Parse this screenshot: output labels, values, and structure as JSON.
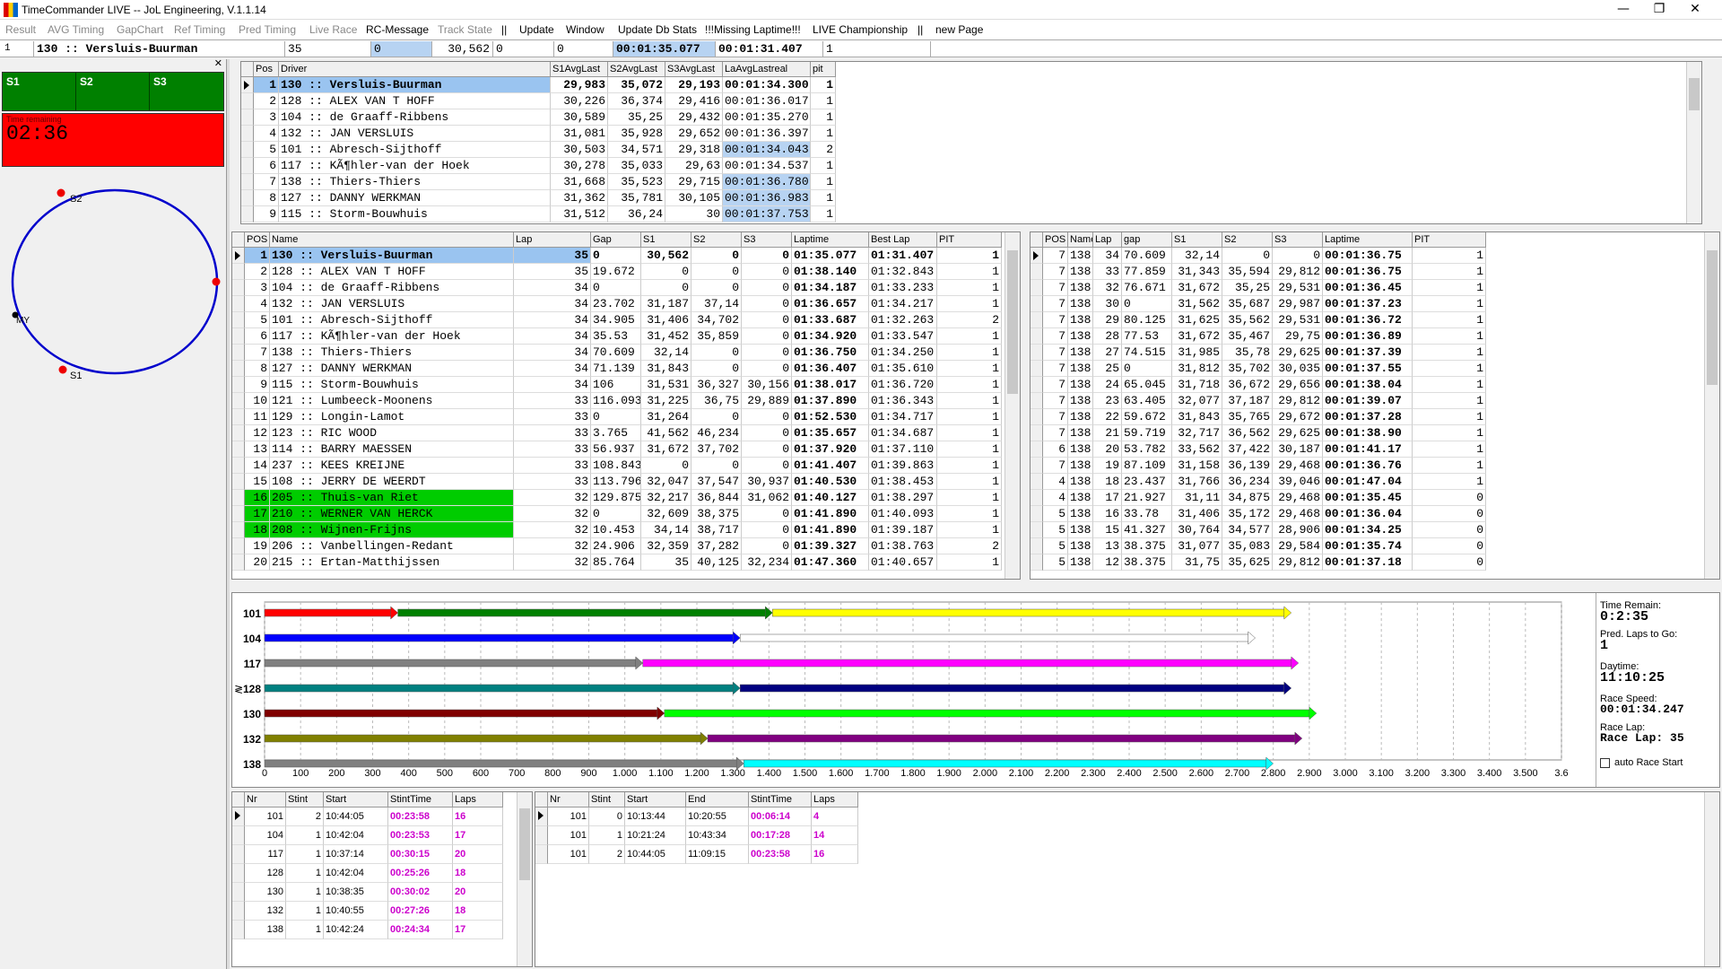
{
  "window": {
    "title": "TimeCommander LIVE -- JoL Engineering, V.1.1.14",
    "minimize": "—",
    "maximize": "❐",
    "close": "✕"
  },
  "menu": [
    "Result",
    "AVG Timing",
    "GapChart",
    "Ref Timing",
    "Pred Timing",
    "Live Race",
    "RC-Message",
    "Track State",
    "||",
    "Update",
    "Window",
    "Update Db Stats",
    "!!!Missing Laptime!!!",
    "LIVE Championship",
    "||",
    "new Page"
  ],
  "infobar": {
    "index": "1",
    "driver": "130  ::  Versluis-Buurman",
    "lap": "35",
    "v1": "0",
    "v2": "30,562",
    "v3": "0",
    "v4": "0",
    "laptime": "00:01:35.077",
    "best": "00:01:31.407",
    "pit": "1"
  },
  "sectors": {
    "s1": "S1",
    "s2": "S2",
    "s3": "S3",
    "time_remaining_label": "Time remaining",
    "time_remaining": "02:36"
  },
  "track": {
    "s1": "S1",
    "s2": "S2",
    "my": "MY"
  },
  "avg_table": {
    "headers": [
      "Pos",
      "Driver",
      "S1AvgLast",
      "S2AvgLast",
      "S3AvgLast",
      "LaAvgLastreal",
      "pit"
    ],
    "rows": [
      [
        "1",
        "130  ::  Versluis-Buurman",
        "29,983",
        "35,072",
        "29,193",
        "00:01:34.300",
        "1"
      ],
      [
        "2",
        "128  ::  ALEX VAN T HOFF",
        "30,226",
        "36,374",
        "29,416",
        "00:01:36.017",
        "1"
      ],
      [
        "3",
        "104  ::  de Graaff-Ribbens",
        "30,589",
        "35,25",
        "29,432",
        "00:01:35.270",
        "1"
      ],
      [
        "4",
        "132  ::  JAN VERSLUIS",
        "31,081",
        "35,928",
        "29,652",
        "00:01:36.397",
        "1"
      ],
      [
        "5",
        "101  ::  Abresch-Sijthoff",
        "30,503",
        "34,571",
        "29,318",
        "00:01:34.043",
        "2"
      ],
      [
        "6",
        "117  ::  KÃ¶hler-van der Hoek",
        "30,278",
        "35,033",
        "29,63",
        "00:01:34.537",
        "1"
      ],
      [
        "7",
        "138  ::  Thiers-Thiers",
        "31,668",
        "35,523",
        "29,715",
        "00:01:36.780",
        "1"
      ],
      [
        "8",
        "127  ::  DANNY WERKMAN",
        "31,362",
        "35,781",
        "30,105",
        "00:01:36.983",
        "1"
      ],
      [
        "9",
        "115  ::  Storm-Bouwhuis",
        "31,512",
        "36,24",
        "30",
        "00:01:37.753",
        "1"
      ]
    ]
  },
  "race_table": {
    "headers": [
      "POS",
      "Name",
      "Lap",
      "Gap",
      "S1",
      "S2",
      "S3",
      "Laptime",
      "Best Lap",
      "PIT"
    ],
    "rows": [
      [
        "1",
        "130  ::  Versluis-Buurman",
        "35",
        "0",
        "30,562",
        "0",
        "0",
        "01:35.077",
        "01:31.407",
        "1"
      ],
      [
        "2",
        "128  ::  ALEX VAN T HOFF",
        "35",
        "19.672",
        "0",
        "0",
        "0",
        "01:38.140",
        "01:32.843",
        "1"
      ],
      [
        "3",
        "104  ::  de Graaff-Ribbens",
        "34",
        "0",
        "0",
        "0",
        "0",
        "01:34.187",
        "01:33.233",
        "1"
      ],
      [
        "4",
        "132  ::  JAN VERSLUIS",
        "34",
        "23.702",
        "31,187",
        "37,14",
        "0",
        "01:36.657",
        "01:34.217",
        "1"
      ],
      [
        "5",
        "101  ::  Abresch-Sijthoff",
        "34",
        "34.905",
        "31,406",
        "34,702",
        "0",
        "01:33.687",
        "01:32.263",
        "2"
      ],
      [
        "6",
        "117  ::  KÃ¶hler-van der Hoek",
        "34",
        "35.53",
        "31,452",
        "35,859",
        "0",
        "01:34.920",
        "01:33.547",
        "1"
      ],
      [
        "7",
        "138  ::  Thiers-Thiers",
        "34",
        "70.609",
        "32,14",
        "0",
        "0",
        "01:36.750",
        "01:34.250",
        "1"
      ],
      [
        "8",
        "127  ::  DANNY WERKMAN",
        "34",
        "71.139",
        "31,843",
        "0",
        "0",
        "01:36.407",
        "01:35.610",
        "1"
      ],
      [
        "9",
        "115  ::  Storm-Bouwhuis",
        "34",
        "106",
        "31,531",
        "36,327",
        "30,156",
        "01:38.017",
        "01:36.720",
        "1"
      ],
      [
        "10",
        "121  ::  Lumbeeck-Moonens",
        "33",
        "116.093",
        "31,225",
        "36,75",
        "29,889",
        "01:37.890",
        "01:36.343",
        "1"
      ],
      [
        "11",
        "129  ::  Longin-Lamot",
        "33",
        "0",
        "31,264",
        "0",
        "0",
        "01:52.530",
        "01:34.717",
        "1"
      ],
      [
        "12",
        "123  ::  RIC WOOD",
        "33",
        "3.765",
        "41,562",
        "46,234",
        "0",
        "01:35.657",
        "01:34.687",
        "1"
      ],
      [
        "13",
        "114  ::  BARRY MAESSEN",
        "33",
        "56.937",
        "31,672",
        "37,702",
        "0",
        "01:37.920",
        "01:37.110",
        "1"
      ],
      [
        "14",
        "237  ::  KEES KREIJNE",
        "33",
        "108.843",
        "0",
        "0",
        "0",
        "01:41.407",
        "01:39.863",
        "1"
      ],
      [
        "15",
        "108  ::  JERRY DE WEERDT",
        "33",
        "113.796",
        "32,047",
        "37,547",
        "30,937",
        "01:40.530",
        "01:38.453",
        "1"
      ],
      [
        "16",
        "205  ::  Thuis-van Riet",
        "32",
        "129.875",
        "32,217",
        "36,844",
        "31,062",
        "01:40.127",
        "01:38.297",
        "1"
      ],
      [
        "17",
        "210  ::  WERNER VAN HERCK",
        "32",
        "0",
        "32,609",
        "38,375",
        "0",
        "01:41.890",
        "01:40.093",
        "1"
      ],
      [
        "18",
        "208  ::  Wijnen-Frijns",
        "32",
        "10.453",
        "34,14",
        "38,717",
        "0",
        "01:41.890",
        "01:39.187",
        "1"
      ],
      [
        "19",
        "206  ::  Vanbellingen-Redant",
        "32",
        "24.906",
        "32,359",
        "37,282",
        "0",
        "01:39.327",
        "01:38.763",
        "2"
      ],
      [
        "20",
        "215  ::  Ertan-Matthijssen",
        "32",
        "85.764",
        "35",
        "40,125",
        "32,234",
        "01:47.360",
        "01:40.657",
        "1"
      ]
    ]
  },
  "lap_table": {
    "headers": [
      "POS",
      "Name",
      "Lap",
      "gap",
      "S1",
      "S2",
      "S3",
      "Laptime",
      "PIT"
    ],
    "rows": [
      [
        "7",
        "138",
        "34",
        "70.609",
        "32,14",
        "0",
        "0",
        "00:01:36.75",
        "1"
      ],
      [
        "7",
        "138",
        "33",
        "77.859",
        "31,343",
        "35,594",
        "29,812",
        "00:01:36.75",
        "1"
      ],
      [
        "7",
        "138",
        "32",
        "76.671",
        "31,672",
        "35,25",
        "29,531",
        "00:01:36.45",
        "1"
      ],
      [
        "7",
        "138",
        "30",
        "0",
        "31,562",
        "35,687",
        "29,987",
        "00:01:37.23",
        "1"
      ],
      [
        "7",
        "138",
        "29",
        "80.125",
        "31,625",
        "35,562",
        "29,531",
        "00:01:36.72",
        "1"
      ],
      [
        "7",
        "138",
        "28",
        "77.53",
        "31,672",
        "35,467",
        "29,75",
        "00:01:36.89",
        "1"
      ],
      [
        "7",
        "138",
        "27",
        "74.515",
        "31,985",
        "35,78",
        "29,625",
        "00:01:37.39",
        "1"
      ],
      [
        "7",
        "138",
        "25",
        "0",
        "31,812",
        "35,702",
        "30,035",
        "00:01:37.55",
        "1"
      ],
      [
        "7",
        "138",
        "24",
        "65.045",
        "31,718",
        "36,672",
        "29,656",
        "00:01:38.04",
        "1"
      ],
      [
        "7",
        "138",
        "23",
        "63.405",
        "32,077",
        "37,187",
        "29,812",
        "00:01:39.07",
        "1"
      ],
      [
        "7",
        "138",
        "22",
        "59.672",
        "31,843",
        "35,765",
        "29,672",
        "00:01:37.28",
        "1"
      ],
      [
        "7",
        "138",
        "21",
        "59.719",
        "32,717",
        "36,562",
        "29,625",
        "00:01:38.90",
        "1"
      ],
      [
        "6",
        "138",
        "20",
        "53.782",
        "33,562",
        "37,422",
        "30,187",
        "00:01:41.17",
        "1"
      ],
      [
        "7",
        "138",
        "19",
        "87.109",
        "31,158",
        "36,139",
        "29,468",
        "00:01:36.76",
        "1"
      ],
      [
        "4",
        "138",
        "18",
        "23.437",
        "31,766",
        "36,234",
        "39,046",
        "00:01:47.04",
        "1"
      ],
      [
        "4",
        "138",
        "17",
        "21.927",
        "31,11",
        "34,875",
        "29,468",
        "00:01:35.45",
        "0"
      ],
      [
        "5",
        "138",
        "16",
        "33.78",
        "31,406",
        "35,172",
        "29,468",
        "00:01:36.04",
        "0"
      ],
      [
        "5",
        "138",
        "15",
        "41.327",
        "30,764",
        "34,577",
        "28,906",
        "00:01:34.25",
        "0"
      ],
      [
        "5",
        "138",
        "13",
        "38.375",
        "31,077",
        "35,083",
        "29,584",
        "00:01:35.74",
        "0"
      ],
      [
        "5",
        "138",
        "12",
        "38.375",
        "31,75",
        "35,625",
        "29,812",
        "00:01:37.18",
        "0"
      ]
    ]
  },
  "stint_chart": {
    "rows": [
      {
        "label": "101",
        "segments": [
          {
            "start": 0,
            "end": 370,
            "color": "#ff0000"
          },
          {
            "start": 370,
            "end": 1410,
            "color": "#008000"
          },
          {
            "start": 1410,
            "end": 2850,
            "color": "#ffff00"
          }
        ]
      },
      {
        "label": "104",
        "segments": [
          {
            "start": 0,
            "end": 1320,
            "color": "#0000ff"
          },
          {
            "start": 1320,
            "end": 2750,
            "color": "#ffffff"
          }
        ]
      },
      {
        "label": "117",
        "segments": [
          {
            "start": 0,
            "end": 1050,
            "color": "#808080"
          },
          {
            "start": 1050,
            "end": 2870,
            "color": "#ff00ff"
          }
        ]
      },
      {
        "label": "128",
        "segments": [
          {
            "start": 0,
            "end": 1320,
            "color": "#008080"
          },
          {
            "start": 1320,
            "end": 2850,
            "color": "#000080"
          }
        ]
      },
      {
        "label": "130",
        "segments": [
          {
            "start": 0,
            "end": 1110,
            "color": "#800000"
          },
          {
            "start": 1110,
            "end": 2920,
            "color": "#00ff00"
          }
        ]
      },
      {
        "label": "132",
        "segments": [
          {
            "start": 0,
            "end": 1230,
            "color": "#808000"
          },
          {
            "start": 1230,
            "end": 2880,
            "color": "#800080"
          }
        ]
      },
      {
        "label": "138",
        "segments": [
          {
            "start": 0,
            "end": 1330,
            "color": "#808080"
          },
          {
            "start": 1330,
            "end": 2800,
            "color": "#00ffff"
          }
        ]
      }
    ],
    "xticks": [
      "0",
      "100",
      "200",
      "300",
      "400",
      "500",
      "600",
      "700",
      "800",
      "900",
      "1.000",
      "1.100",
      "1.200",
      "1.300",
      "1.400",
      "1.500",
      "1.600",
      "1.700",
      "1.800",
      "1.900",
      "2.000",
      "2.100",
      "2.200",
      "2.300",
      "2.400",
      "2.500",
      "2.600",
      "2.700",
      "2.800",
      "2.900",
      "3.000",
      "3.100",
      "3.200",
      "3.300",
      "3.400",
      "3.500",
      "3.6"
    ],
    "xmax": 3600,
    "marker": "≷"
  },
  "race_info": {
    "time_remain_label": "Time Remain:",
    "time_remain": "0:2:35",
    "pred_laps_label": "Pred. Laps to Go:",
    "pred_laps": "1",
    "daytime_label": "Daytime:",
    "daytime": "11:10:25",
    "race_speed_label": "Race Speed:",
    "race_speed": "00:01:34.247",
    "race_lap_label": "Race Lap:",
    "race_lap": "Race Lap: 35",
    "auto_start_label": "auto Race Start"
  },
  "stint_table": {
    "headers": [
      "Nr",
      "Stint",
      "Start",
      "StintTime",
      "Laps"
    ],
    "rows": [
      [
        "101",
        "2",
        "10:44:05",
        "00:23:58",
        "16"
      ],
      [
        "104",
        "1",
        "10:42:04",
        "00:23:53",
        "17"
      ],
      [
        "117",
        "1",
        "10:37:14",
        "00:30:15",
        "20"
      ],
      [
        "128",
        "1",
        "10:42:04",
        "00:25:26",
        "18"
      ],
      [
        "130",
        "1",
        "10:38:35",
        "00:30:02",
        "20"
      ],
      [
        "132",
        "1",
        "10:40:55",
        "00:27:26",
        "18"
      ],
      [
        "138",
        "1",
        "10:42:24",
        "00:24:34",
        "17"
      ]
    ]
  },
  "stint_detail": {
    "headers": [
      "Nr",
      "Stint",
      "Start",
      "End",
      "StintTime",
      "Laps"
    ],
    "rows": [
      [
        "101",
        "0",
        "10:13:44",
        "10:20:55",
        "00:06:14",
        "4"
      ],
      [
        "101",
        "1",
        "10:21:24",
        "10:43:34",
        "00:17:28",
        "14"
      ],
      [
        "101",
        "2",
        "10:44:05",
        "11:09:15",
        "00:23:58",
        "16"
      ]
    ]
  },
  "colors": {
    "accent_magenta": "#cc00cc",
    "selected": "#9ac4f0",
    "green": "#00cc00",
    "red": "#ff0000",
    "sector_green": "#008000"
  }
}
